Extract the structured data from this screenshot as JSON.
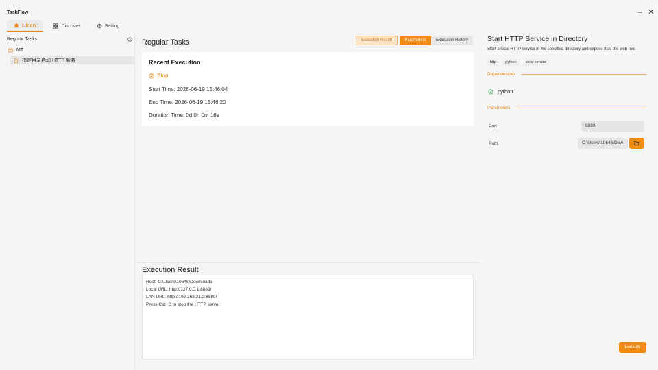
{
  "app": {
    "title": "TaskFlow"
  },
  "window": {
    "minimize": "–",
    "close": "✕"
  },
  "nav": {
    "tabs": [
      {
        "label": "Library",
        "icon": "home-icon",
        "active": true
      },
      {
        "label": "Discover",
        "icon": "grid-icon",
        "active": false
      },
      {
        "label": "Setting",
        "icon": "gear-icon",
        "active": false
      }
    ]
  },
  "sidebar": {
    "header": "Regular Tasks",
    "group": "MT",
    "items": [
      {
        "label": "指定目录启动 HTTP 服务"
      }
    ]
  },
  "main": {
    "title": "Regular Tasks",
    "tabs": {
      "result": "Execution Result",
      "params": "Parameters",
      "history": "Execution History"
    },
    "recent": {
      "title": "Recent Execution",
      "stop_label": "Stop",
      "start_time": "Start Time: 2026-06-19 15:46:04",
      "end_time": "End Time: 2026-06-19 15:46:20",
      "duration": "Duration Time: 0d 0h 0m 16s"
    },
    "result": {
      "title": "Execution Result",
      "lines": [
        "Root: C:\\Users\\10646\\Downloads",
        "Local URL: http://127.0.0.1:8889/",
        "LAN URL: http://192.168.21.2:8889/",
        "Press Ctrl+C to stop the HTTP server."
      ]
    }
  },
  "detail": {
    "title": "Start HTTP Service in Directory",
    "description": "Start a local HTTP service in the specified directory and expose it as the web root",
    "tags": [
      "http",
      "python",
      "local-service"
    ],
    "dependencies_label": "Dependencies",
    "dependencies": [
      "python"
    ],
    "parameters_label": "Parameters",
    "params": {
      "port_label": "Port",
      "port_value": "8889",
      "path_label": "Path",
      "path_value": "C:\\Users\\10646\\Dow"
    },
    "execute_label": "Execute"
  },
  "colors": {
    "accent": "#ef8a12",
    "success": "#3aa655"
  }
}
